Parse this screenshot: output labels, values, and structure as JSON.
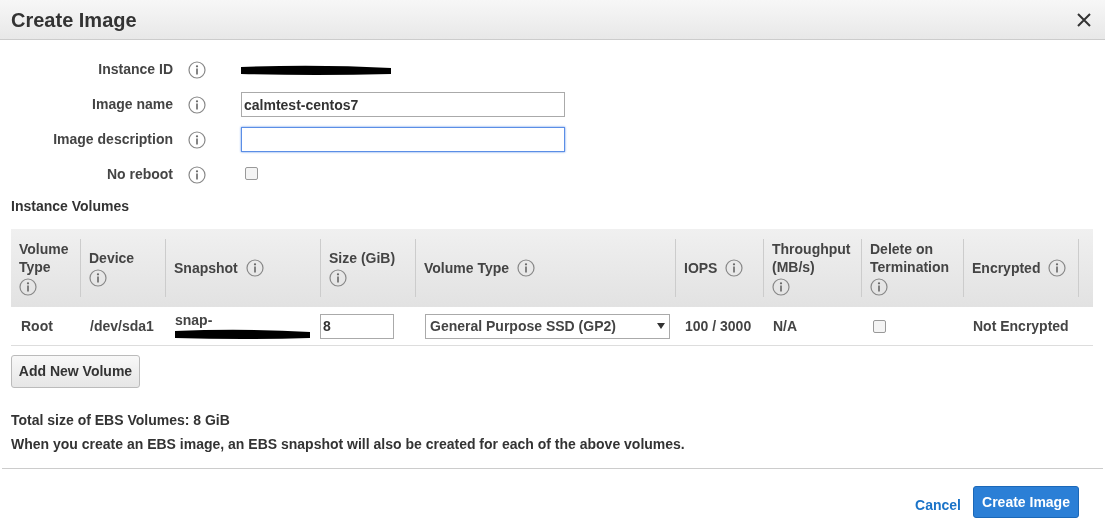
{
  "dialog": {
    "title": "Create Image"
  },
  "form": [
    {
      "kind": "redacted",
      "label": "Instance ID"
    },
    {
      "kind": "text",
      "label": "Image name",
      "value": "calmtest-centos7",
      "focused": false
    },
    {
      "kind": "text",
      "label": "Image description",
      "focused": true
    },
    {
      "kind": "checkbox",
      "label": "No reboot",
      "checked": false
    }
  ],
  "volumes": {
    "heading": "Instance Volumes",
    "columns": [
      "Volume Type",
      "Device",
      "Snapshot",
      "Size (GiB)",
      "Volume Type",
      "IOPS",
      "Throughput (MB/s)",
      "Delete on Termination",
      "Encrypted"
    ],
    "rows": [
      {
        "volume_type": "Root",
        "device": "/dev/sda1",
        "snapshot": "snap-",
        "size": "8",
        "type": "General Purpose SSD (GP2)",
        "iops": "100 / 3000",
        "throughput": "N/A",
        "delete_on_termination": false,
        "encrypted": "Not Encrypted"
      }
    ]
  },
  "add_button": "Add New Volume",
  "summary": [
    "Total size of EBS Volumes: 8 GiB",
    "When you create an EBS image, an EBS snapshot will also be created for each of the above volumes."
  ],
  "footer": {
    "cancel": "Cancel",
    "submit": "Create Image"
  }
}
